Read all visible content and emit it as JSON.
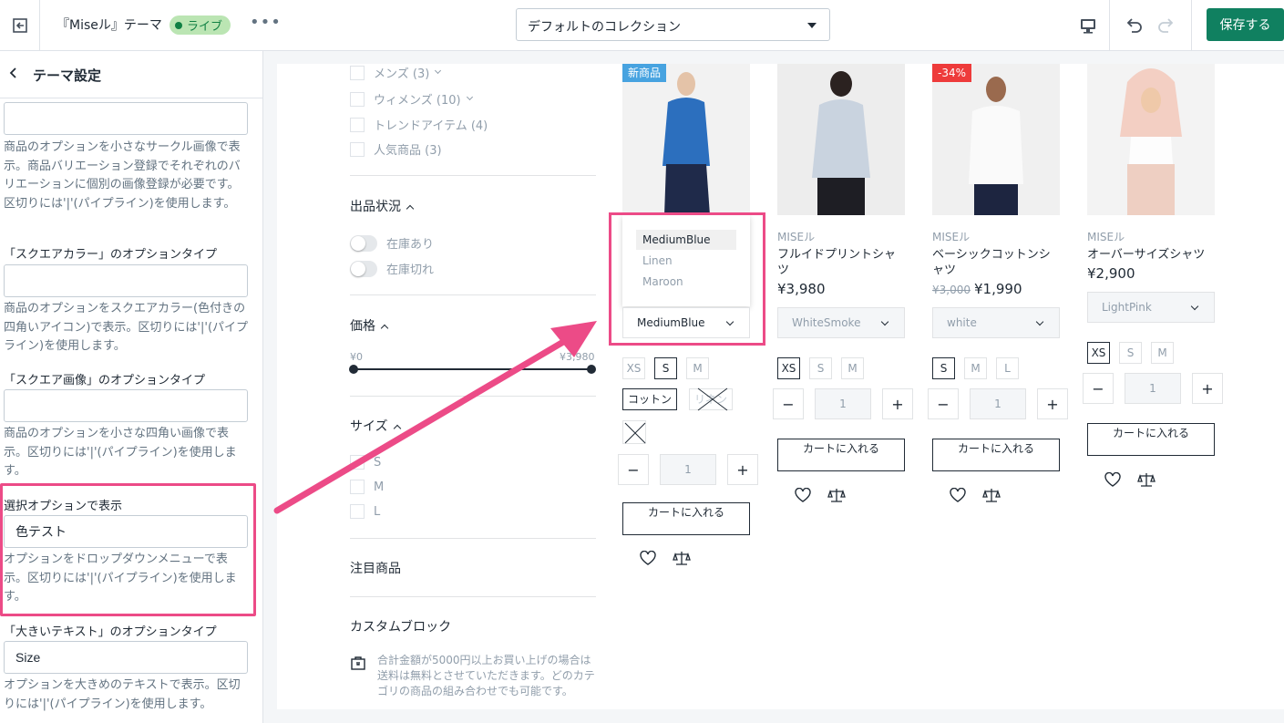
{
  "topbar": {
    "theme_name": "『Miseル』テーマ",
    "live_badge": "ライブ",
    "more": "•••",
    "collection_select": "デフォルトのコレクション",
    "save_label": "保存する"
  },
  "sidebar": {
    "title": "テーマ設定",
    "blocks": [
      {
        "label": "",
        "value": "",
        "help": "商品のオプションを小さなサークル画像で表示。商品バリエーション登録でそれぞれのバリエーションに個別の画像登録が必要です。区切りには'|'(パイプライン)を使用します。"
      },
      {
        "label": "「スクエアカラー」のオプションタイプ",
        "value": "",
        "help": "商品のオプションをスクエアカラー(色付きの四角いアイコン)で表示。区切りには'|'(パイプライン)を使用します。"
      },
      {
        "label": "「スクエア画像」のオプションタイプ",
        "value": "",
        "help": "商品のオプションを小さな四角い画像で表示。区切りには'|'(パイプライン)を使用します。"
      },
      {
        "label": "選択オプションで表示",
        "value": "色テスト",
        "help": "オプションをドロップダウンメニューで表示。区切りには'|'(パイプライン)を使用します。"
      },
      {
        "label": "「大きいテキスト」のオプションタイプ",
        "value": "Size",
        "help": "オプションを大きめのテキストで表示。区切りには'|'(パイプライン)を使用します。"
      }
    ]
  },
  "filters": {
    "categories": [
      "メンズ (3)",
      "ウィメンズ (10)",
      "トレンドアイテム (4)",
      "人気商品 (3)"
    ],
    "availability_heading": "出品状況",
    "availability": [
      "在庫あり",
      "在庫切れ"
    ],
    "price_heading": "価格",
    "price_min": "¥0",
    "price_max": "¥3,980",
    "size_heading": "サイズ",
    "sizes": [
      "S",
      "M",
      "L"
    ],
    "featured_heading": "注目商品",
    "custom_heading": "カスタムブロック",
    "custom_text": "合計金額が5000円以上お買い上げの場合は送料は無料とさせていただきます。どのカテゴリの商品の組み合わせでも可能です。"
  },
  "products": [
    {
      "badge": "新商品",
      "dropdown_options": [
        "MediumBlue",
        "Linen",
        "Maroon"
      ],
      "select": "MediumBlue",
      "sizes": [
        "XS",
        "S",
        "M"
      ],
      "materials": [
        "コットン",
        "リネン"
      ],
      "qty": "1",
      "cart": "カートに入れる"
    },
    {
      "brand": "MISEル",
      "title": "フルイドプリントシャツ",
      "price": "¥3,980",
      "select": "WhiteSmoke",
      "sizes": [
        "XS",
        "S",
        "M"
      ],
      "qty": "1",
      "cart": "カートに入れる"
    },
    {
      "badge": "-34%",
      "brand": "MISEル",
      "title": "ベーシックコットンシャツ",
      "was": "¥3,000",
      "price": "¥1,990",
      "select": "white",
      "sizes": [
        "S",
        "M",
        "L"
      ],
      "qty": "1",
      "cart": "カートに入れる"
    },
    {
      "brand": "MISEル",
      "title": "オーバーサイズシャツ",
      "price": "¥2,900",
      "select": "LightPink",
      "sizes": [
        "XS",
        "S",
        "M"
      ],
      "qty": "1",
      "cart": "カートに入れる"
    }
  ],
  "colors": {
    "accent": "#108060",
    "highlight": "#ec4b87",
    "live_bg": "#bbe5b3",
    "badge_new": "#47a3e0",
    "badge_sale": "#ee3b3b"
  },
  "qty_controls": {
    "minus": "−",
    "plus": "+"
  }
}
